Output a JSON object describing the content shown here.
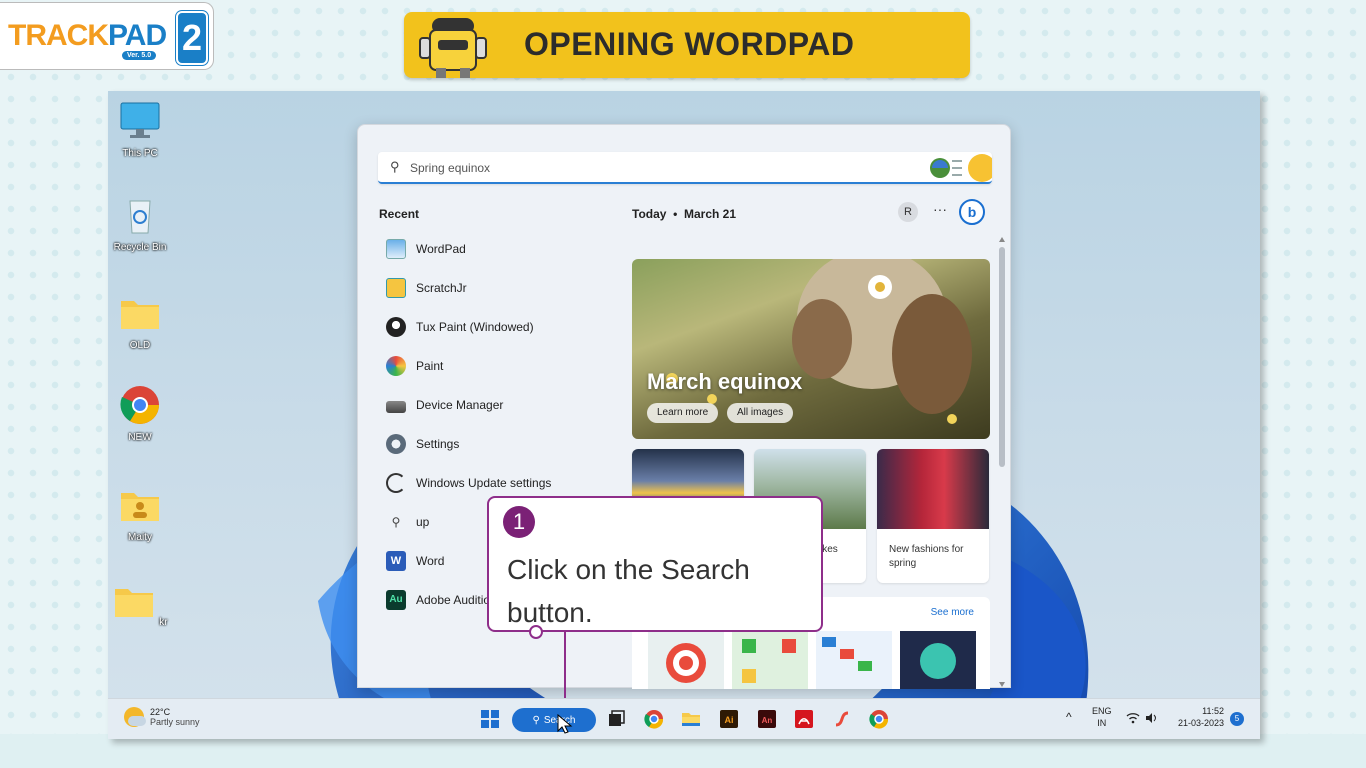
{
  "brand": {
    "logo_main": "TRACK",
    "logo_accent": "PAD",
    "version": "Ver. 5.0",
    "badge": "2"
  },
  "banner": {
    "title": "OPENING WORDPAD"
  },
  "desktop": {
    "icons": [
      {
        "label": "This PC",
        "icon": "monitor-icon"
      },
      {
        "label": "Recycle Bin",
        "icon": "recycle-bin-icon"
      },
      {
        "label": "OLD",
        "icon": "folder-icon"
      },
      {
        "label": "NEW",
        "icon": "chrome-icon"
      },
      {
        "label": "Maity",
        "icon": "user-folder-icon"
      },
      {
        "label": "kr",
        "icon": "folder-icon"
      }
    ]
  },
  "search_panel": {
    "query": "Spring equinox",
    "recent_title": "Recent",
    "recent_items": [
      {
        "label": "WordPad",
        "icon": "wordpad-icon"
      },
      {
        "label": "ScratchJr",
        "icon": "scratchjr-icon"
      },
      {
        "label": "Tux Paint (Windowed)",
        "icon": "tux-paint-icon"
      },
      {
        "label": "Paint",
        "icon": "paint-icon"
      },
      {
        "label": "Device Manager",
        "icon": "device-manager-icon"
      },
      {
        "label": "Settings",
        "icon": "gear-icon"
      },
      {
        "label": "Windows Update settings",
        "icon": "refresh-icon"
      },
      {
        "label": "up",
        "icon": "search-icon"
      },
      {
        "label": "Word",
        "icon": "word-icon"
      },
      {
        "label": "Adobe Auditio",
        "icon": "audition-icon"
      }
    ],
    "today_label": "Today",
    "today_separator": "•",
    "today_date": "March 21",
    "avatar_initial": "R",
    "more_label": "···",
    "bing_label": "b",
    "hero": {
      "title": "March equinox",
      "btn_learn": "Learn more",
      "btn_images": "All images"
    },
    "cards": [
      {
        "caption": ""
      },
      {
        "caption": "ikes"
      },
      {
        "caption": "New fashions for spring"
      }
    ],
    "see_more": "See more"
  },
  "callout": {
    "step": "1",
    "text": "Click on the Search button."
  },
  "taskbar": {
    "temp": "22°C",
    "condition": "Partly sunny",
    "search_label": "Search",
    "lang_top": "ENG",
    "lang_bottom": "IN",
    "time": "11:52",
    "date": "21-03-2023",
    "notif_count": "5",
    "chevron": "^"
  }
}
